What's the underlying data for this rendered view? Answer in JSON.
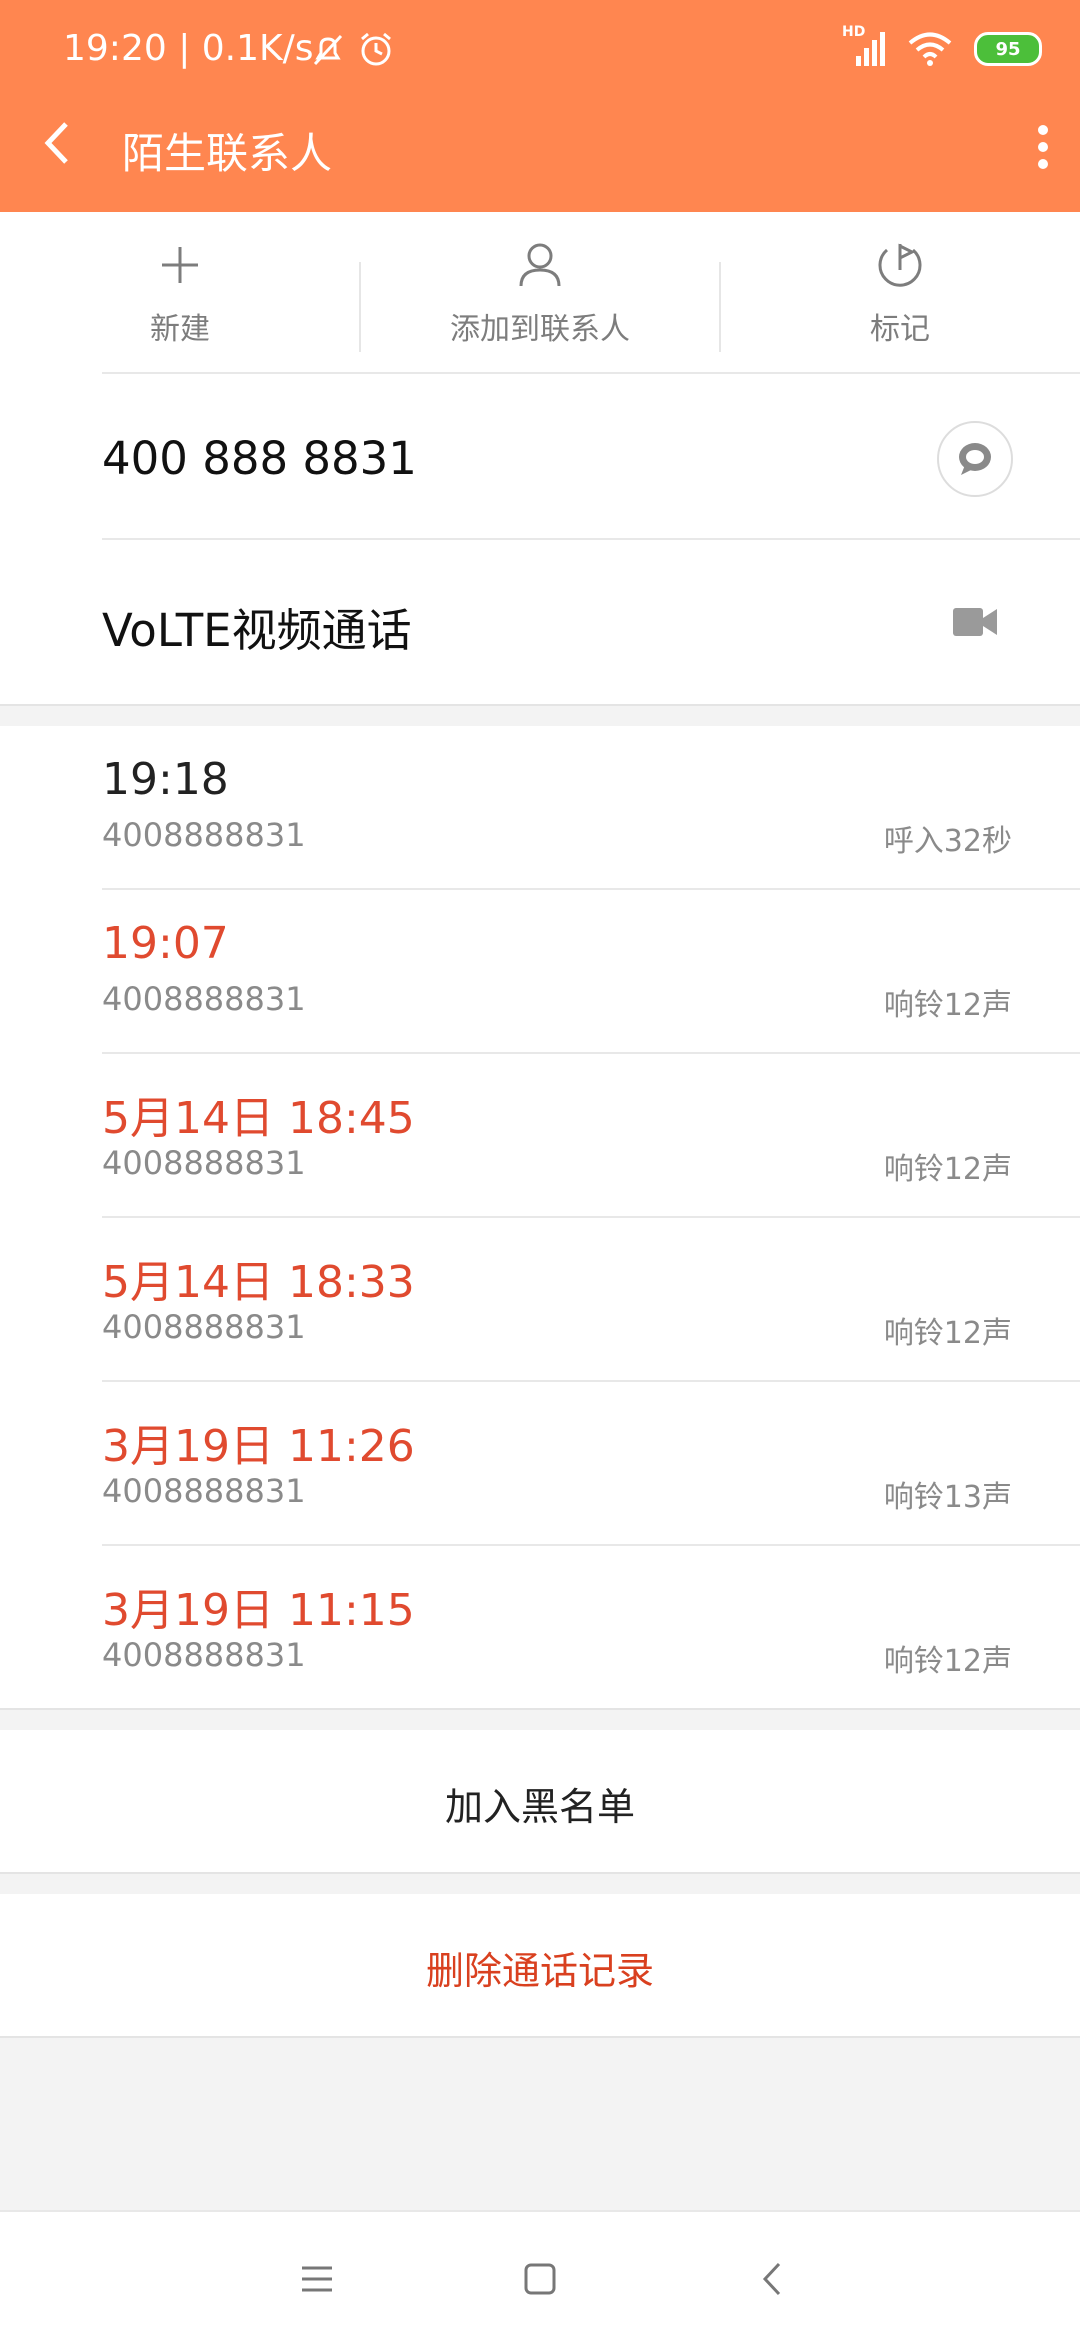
{
  "status_bar": {
    "time_speed": "19:20 | 0.1K/s",
    "network": "HD",
    "battery": "95"
  },
  "header": {
    "title": "陌生联系人"
  },
  "actions": [
    {
      "label": "新建",
      "icon": "plus-icon"
    },
    {
      "label": "添加到联系人",
      "icon": "person-icon"
    },
    {
      "label": "标记",
      "icon": "flag-icon"
    }
  ],
  "phone": {
    "number": "400 888 8831"
  },
  "volte": {
    "label": "VoLTE视频通话"
  },
  "calls": [
    {
      "time": "19:18",
      "number": "4008888831",
      "detail": "呼入32秒",
      "missed": false
    },
    {
      "time": "19:07",
      "number": "4008888831",
      "detail": "响铃12声",
      "missed": true
    },
    {
      "time": "5月14日 18:45",
      "number": "4008888831",
      "detail": "响铃12声",
      "missed": true
    },
    {
      "time": "5月14日 18:33",
      "number": "4008888831",
      "detail": "响铃12声",
      "missed": true
    },
    {
      "time": "3月19日 11:26",
      "number": "4008888831",
      "detail": "响铃13声",
      "missed": true
    },
    {
      "time": "3月19日 11:15",
      "number": "4008888831",
      "detail": "响铃12声",
      "missed": true
    }
  ],
  "blacklist_button": "加入黑名单",
  "delete_button": "删除通话记录",
  "colors": {
    "header": "#ff8650",
    "missed": "#e04a2f",
    "delete": "#d9401f"
  }
}
